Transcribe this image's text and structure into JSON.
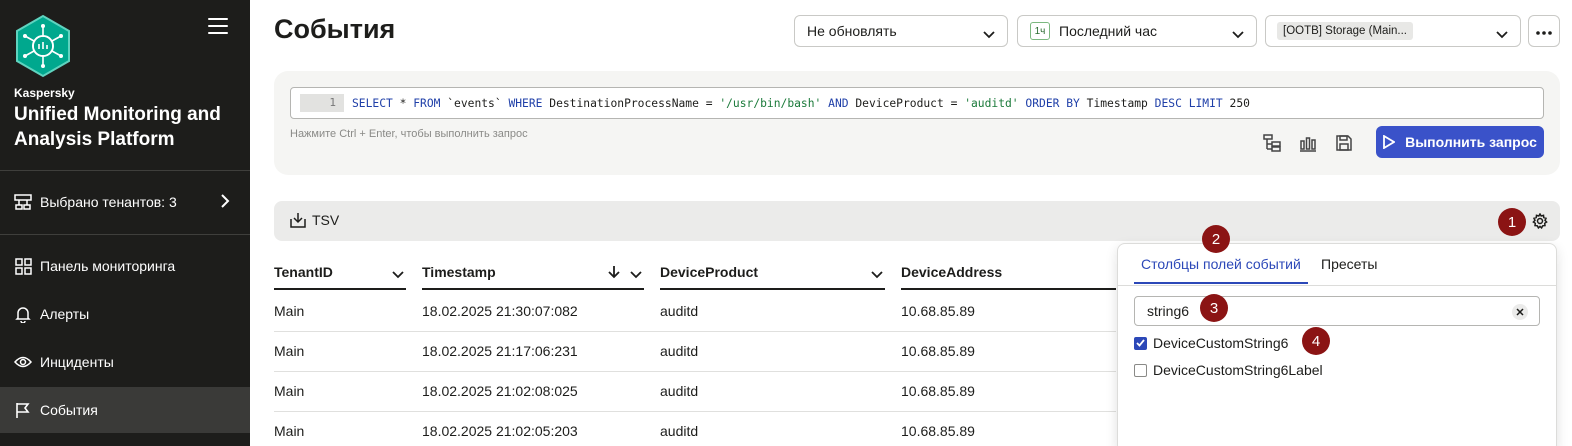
{
  "sidebar": {
    "brand_small": "Kaspersky",
    "brand_big": "Unified Monitoring and Analysis Platform",
    "tenant_selector": "Выбрано тенантов: 3",
    "nav": [
      {
        "label": "Панель мониторинга",
        "icon": "dashboard-icon"
      },
      {
        "label": "Алерты",
        "icon": "bell-icon"
      },
      {
        "label": "Инциденты",
        "icon": "eye-icon"
      },
      {
        "label": "События",
        "icon": "flag-icon",
        "active": true
      }
    ]
  },
  "header": {
    "title": "События",
    "refresh_select": "Не обновлять",
    "period_badge": "1ч",
    "period_select": "Последний час",
    "storage_select": "[OOTB] Storage (Main..."
  },
  "query": {
    "line_number": "1",
    "tokens": {
      "t1": "SELECT",
      "t2": " * ",
      "t3": "FROM",
      "t4": " `events` ",
      "t5": "WHERE",
      "t6": " DestinationProcessName = ",
      "t7": "'/usr/bin/bash'",
      "t8": " ",
      "t9": "AND",
      "t10": " DeviceProduct = ",
      "t11": "'auditd'",
      "t12": " ",
      "t13": "ORDER BY",
      "t14": " Timestamp ",
      "t15": "DESC",
      "t16": " ",
      "t17": "LIMIT",
      "t18": " 250"
    },
    "hint": "Нажмите Ctrl + Enter, чтобы выполнить запрос",
    "run_label": "Выполнить запрос"
  },
  "results": {
    "export_label": "TSV"
  },
  "table": {
    "columns": [
      "TenantID",
      "Timestamp",
      "DeviceProduct",
      "DeviceAddress"
    ],
    "rows": [
      [
        "Main",
        "18.02.2025 21:30:07:082",
        "auditd",
        "10.68.85.89"
      ],
      [
        "Main",
        "18.02.2025 21:17:06:231",
        "auditd",
        "10.68.85.89"
      ],
      [
        "Main",
        "18.02.2025 21:02:08:025",
        "auditd",
        "10.68.85.89"
      ],
      [
        "Main",
        "18.02.2025 21:02:05:203",
        "auditd",
        "10.68.85.89"
      ]
    ]
  },
  "columns_panel": {
    "tab_fields": "Столбцы полей событий",
    "tab_presets": "Пресеты",
    "search_value": "string6",
    "options": [
      {
        "label": "DeviceCustomString6",
        "checked": true
      },
      {
        "label": "DeviceCustomString6Label",
        "checked": false
      }
    ]
  },
  "callouts": [
    "1",
    "2",
    "3",
    "4"
  ],
  "colors": {
    "sidebar_bg": "#1d1d1b",
    "accent": "#3a52c9",
    "callout": "#8b1414"
  }
}
